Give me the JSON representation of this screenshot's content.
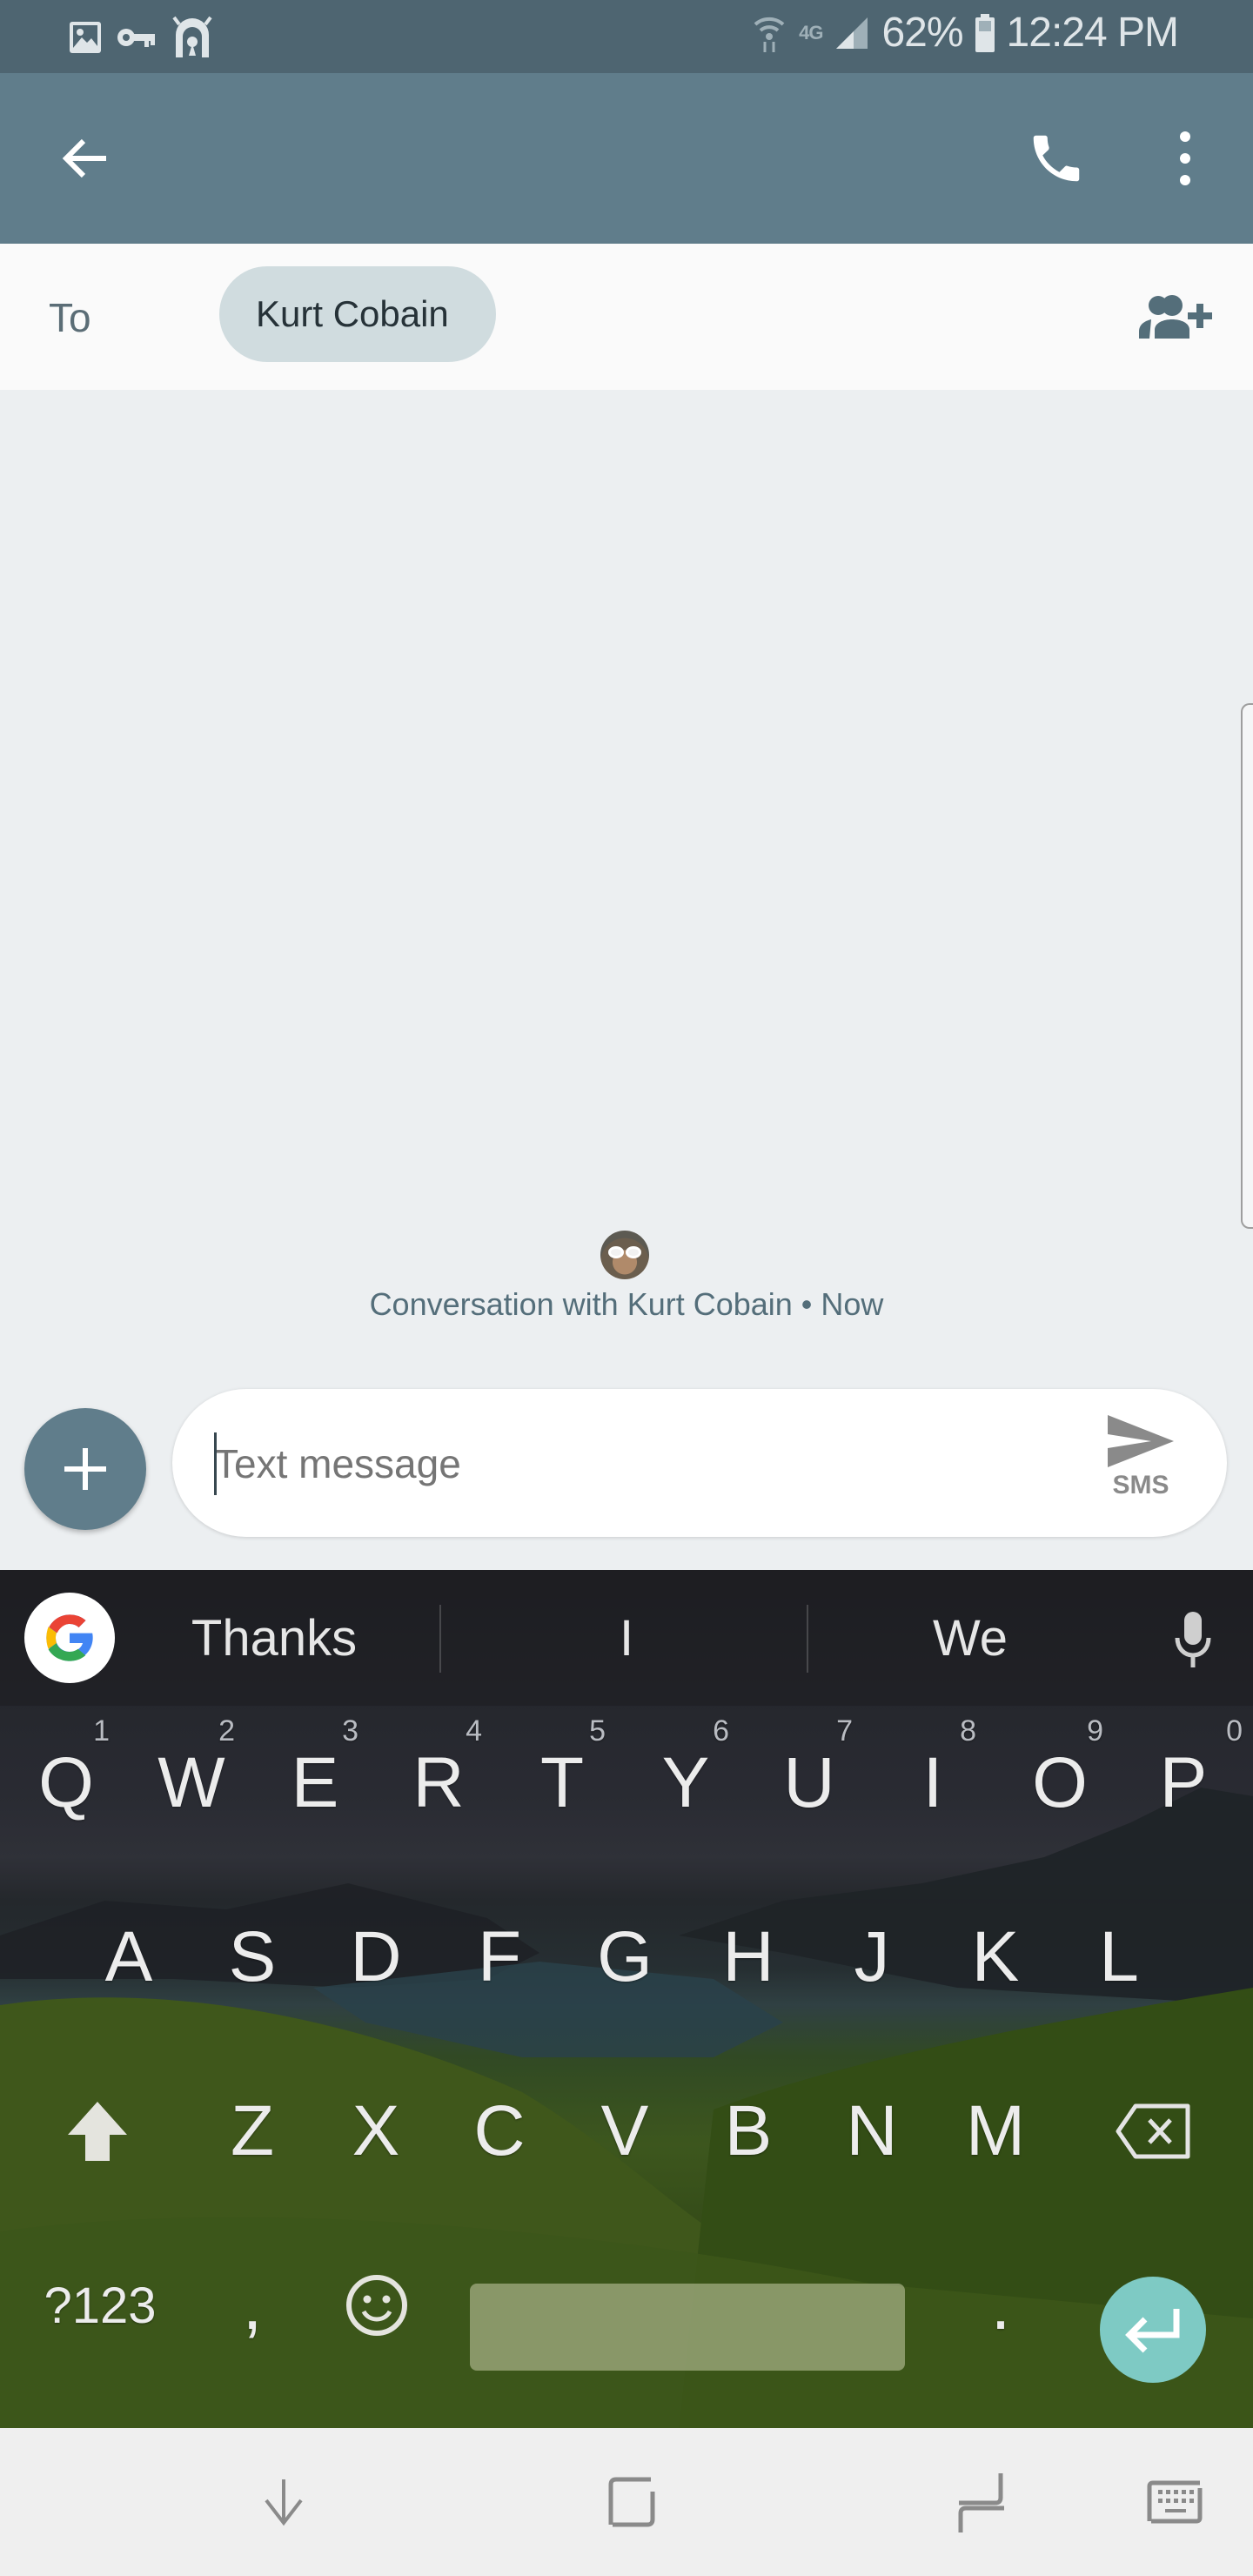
{
  "status_bar": {
    "left_icons": [
      "gallery-icon",
      "vpn-key-icon",
      "secure-folder-icon"
    ],
    "network_type": "4G",
    "battery_percent": "62%",
    "time": "12:24 PM"
  },
  "app_bar": {
    "back_icon": "arrow-left-icon",
    "call_icon": "phone-icon",
    "more_icon": "more-vertical-icon"
  },
  "recipient": {
    "to_label": "To",
    "chip_name": "Kurt Cobain",
    "add_icon": "group-add-icon"
  },
  "conversation": {
    "info_text": "Conversation with Kurt Cobain • Now"
  },
  "compose": {
    "attach_icon": "plus-icon",
    "placeholder": "Text message",
    "value": "",
    "send_label": "SMS",
    "send_icon": "send-icon"
  },
  "keyboard": {
    "suggestions": [
      "Thanks",
      "I",
      "We"
    ],
    "row1": [
      {
        "key": "Q",
        "hint": "1"
      },
      {
        "key": "W",
        "hint": "2"
      },
      {
        "key": "E",
        "hint": "3"
      },
      {
        "key": "R",
        "hint": "4"
      },
      {
        "key": "T",
        "hint": "5"
      },
      {
        "key": "Y",
        "hint": "6"
      },
      {
        "key": "U",
        "hint": "7"
      },
      {
        "key": "I",
        "hint": "8"
      },
      {
        "key": "O",
        "hint": "9"
      },
      {
        "key": "P",
        "hint": "0"
      }
    ],
    "row2": [
      "A",
      "S",
      "D",
      "F",
      "G",
      "H",
      "J",
      "K",
      "L"
    ],
    "row3": [
      "Z",
      "X",
      "C",
      "V",
      "B",
      "N",
      "M"
    ],
    "symbols_label": "?123",
    "comma_label": ",",
    "period_label": ".",
    "accent_color": "#7ecac4"
  },
  "nav_bar": {
    "buttons": [
      "hide-keyboard-icon",
      "recents-icon",
      "back-icon",
      "keyboard-switch-icon"
    ]
  },
  "colors": {
    "app_bar": "#607d8b",
    "status_bar": "#4e6571",
    "chip": "#d0dcdf",
    "background": "#eceff1"
  }
}
